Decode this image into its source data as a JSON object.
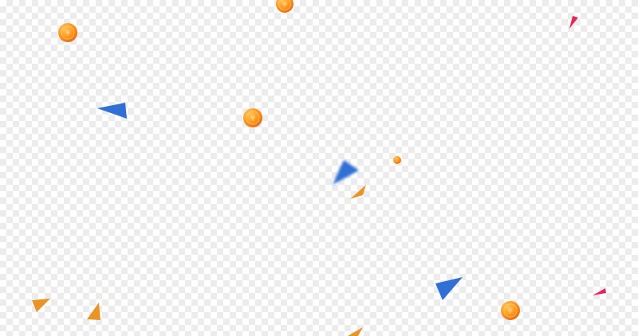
{
  "background": "transparent-checkerboard",
  "coin": {
    "symbol": "¥",
    "colors": {
      "highlight": "#ffc45a",
      "mid": "#ff9a1e",
      "shadow": "#e86a12",
      "symbol": "#ffd98a"
    }
  },
  "colors": {
    "blue": "#2f6fd6",
    "orange": "#e99426",
    "red": "#e8265a"
  },
  "elements": [
    "coin",
    "coin",
    "coin",
    "coin",
    "coin",
    "small-coin",
    "blue-triangle",
    "blue-triangle",
    "blue-triangle",
    "orange-triangle",
    "orange-triangle",
    "orange-triangle",
    "orange-triangle",
    "red-triangle",
    "red-triangle"
  ]
}
